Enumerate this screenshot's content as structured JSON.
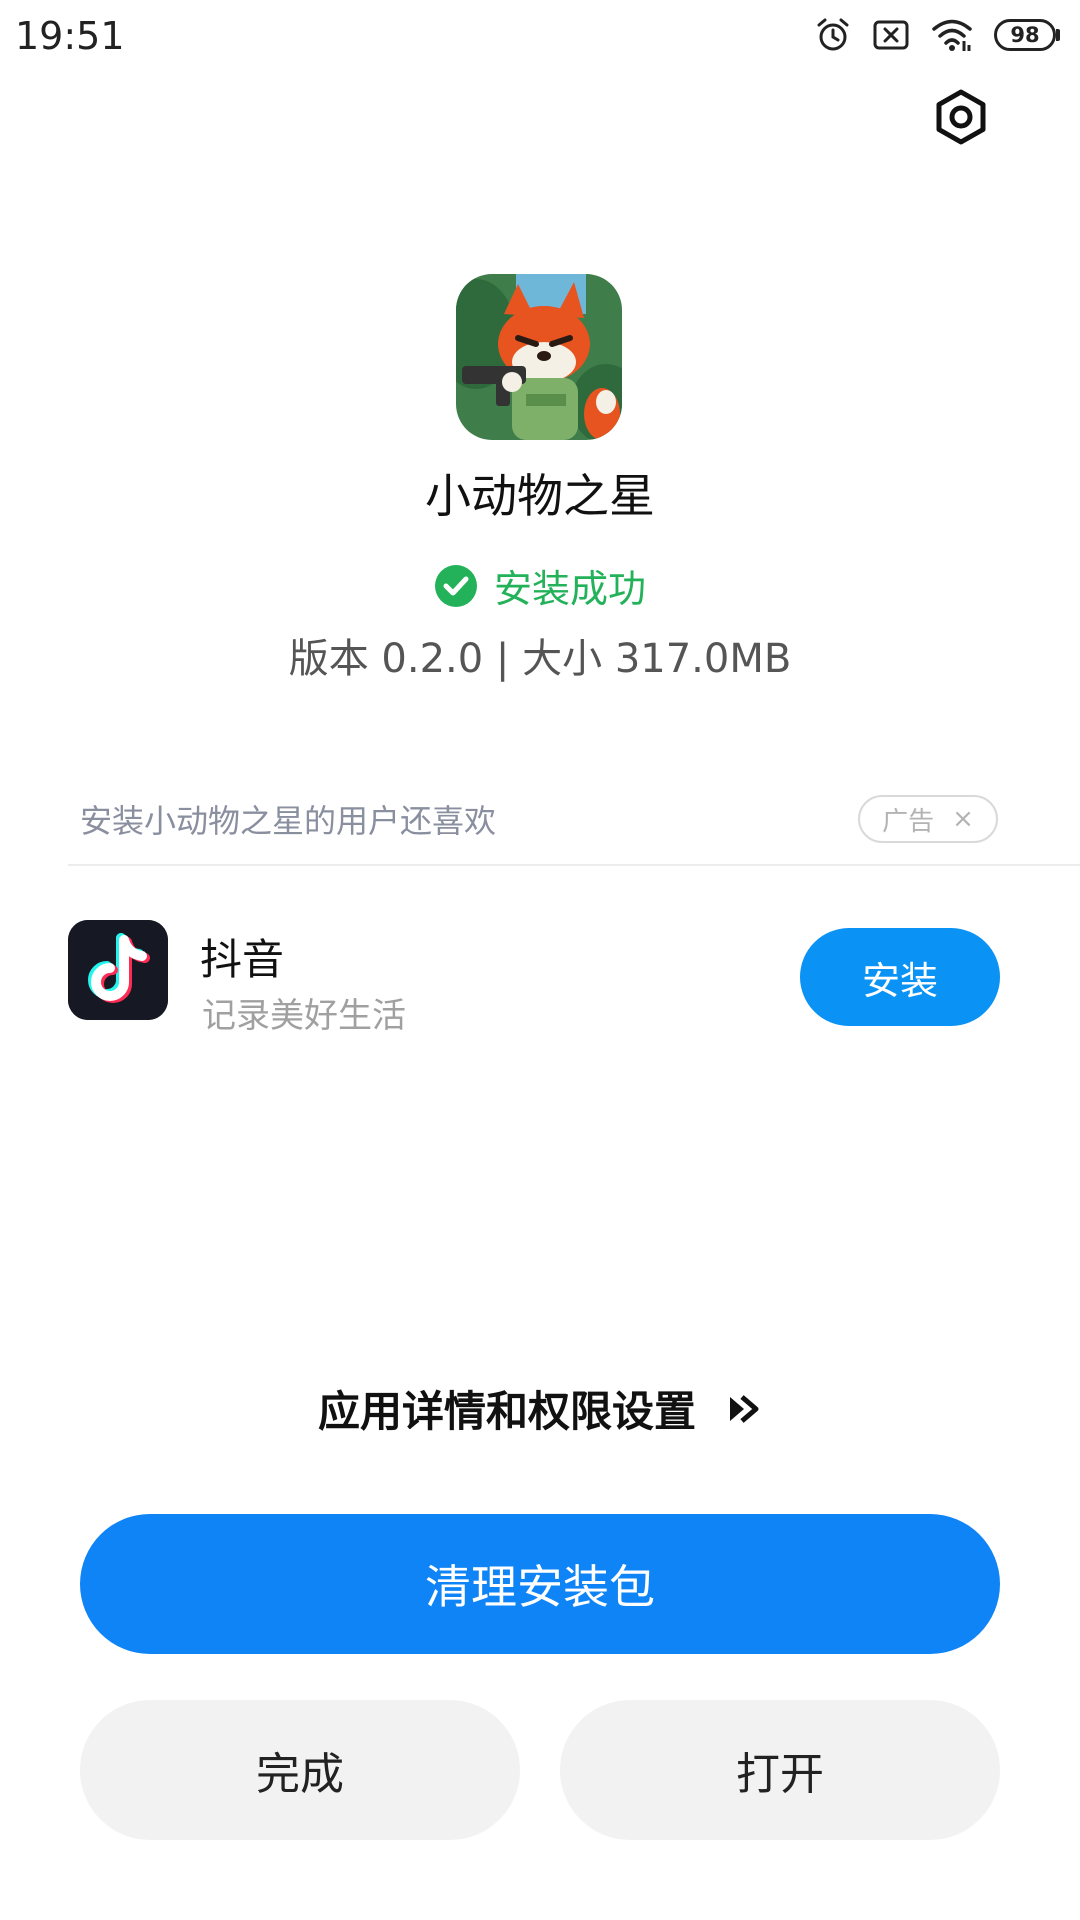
{
  "status_bar": {
    "time": "19:51",
    "icons": [
      "alarm-icon",
      "sim-off-icon",
      "wifi-icon",
      "battery-icon"
    ],
    "battery_level": "98"
  },
  "header": {
    "settings_icon": "gear-icon"
  },
  "app": {
    "name": "小动物之星",
    "install_status": "安装成功",
    "meta": "版本 0.2.0 | 大小 317.0MB"
  },
  "recommendation": {
    "header": "安装小动物之星的用户还喜欢",
    "ad_label": "广告",
    "ad_close": "×",
    "items": [
      {
        "name": "抖音",
        "description": "记录美好生活",
        "button": "安装"
      }
    ]
  },
  "details_link": {
    "label": "应用详情和权限设置"
  },
  "actions": {
    "clean_label": "清理安装包",
    "done_label": "完成",
    "open_label": "打开"
  },
  "colors": {
    "primary": "#0f84f7",
    "success": "#23b15a",
    "install_button": "#0a92f5"
  }
}
